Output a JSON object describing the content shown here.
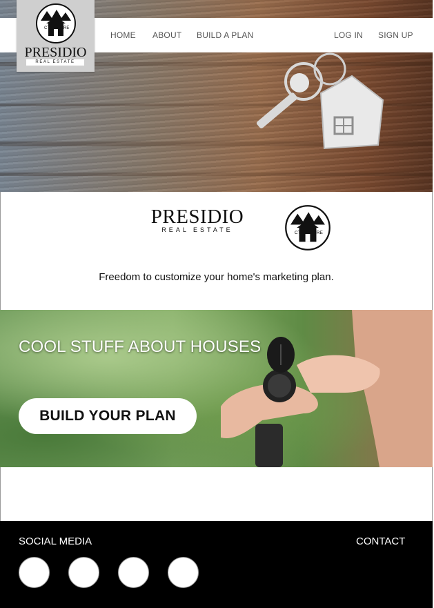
{
  "nav": {
    "links": [
      "HOME",
      "ABOUT",
      "BUILD A PLAN"
    ],
    "auth": [
      "LOG IN",
      "SIGN UP"
    ]
  },
  "logo": {
    "wordmark": "PRESIDIO",
    "subtitle": "REAL ESTATE",
    "emblem_left": "CT",
    "emblem_right": "RE"
  },
  "brand": {
    "name": "PRESIDIO",
    "subtitle": "REAL ESTATE",
    "tagline": "Freedom to customize your home's marketing plan."
  },
  "feature": {
    "title": "COOL STUFF ABOUT HOUSES",
    "cta": "BUILD YOUR PLAN"
  },
  "footer": {
    "social_label": "SOCIAL MEDIA",
    "contact_label": "CONTACT",
    "social_icon_count": 4
  },
  "colors": {
    "footer_bg": "#000000",
    "nav_text": "#555555",
    "logo_box": "#cfcfcf"
  }
}
